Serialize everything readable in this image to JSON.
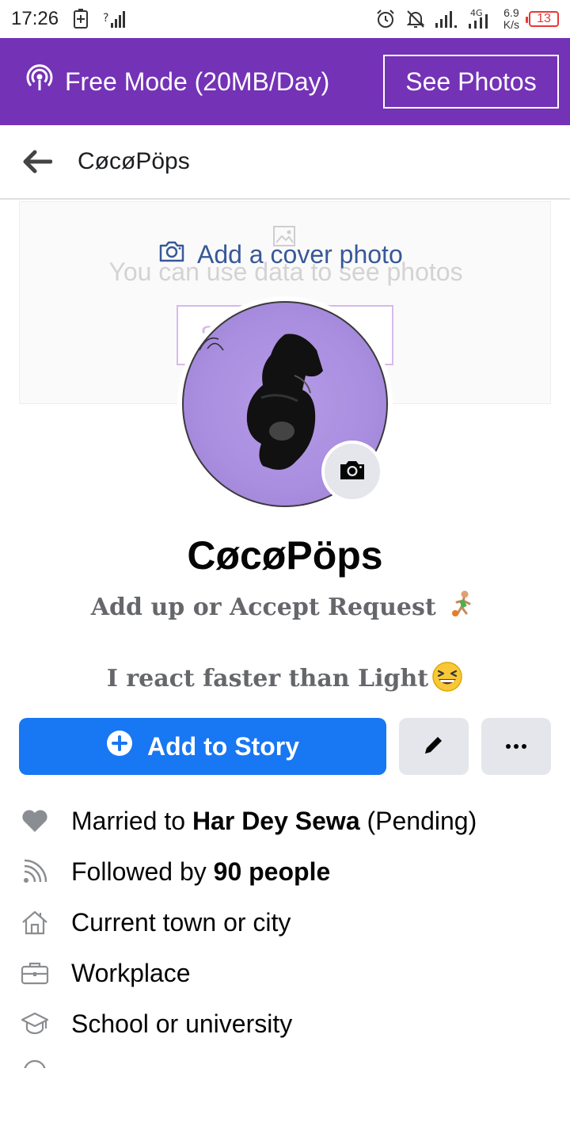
{
  "status_bar": {
    "time": "17:26",
    "speed_value": "6.9",
    "speed_unit": "K/s",
    "network_label": "4G",
    "battery": "13"
  },
  "free_banner": {
    "label": "Free Mode (20MB/Day)",
    "see_photos": "See Photos",
    "color": "#7432b6"
  },
  "nav": {
    "title": "CøcøPöps"
  },
  "cover": {
    "add_cover_label": "Add a cover photo",
    "bg_text": "You can use data to see photos",
    "bg_button_label": "S"
  },
  "profile": {
    "name": "CøcøPöps",
    "bio_line1": "Add up or Accept Request",
    "bio_line2": "I react faster than Light"
  },
  "actions": {
    "add_story": "Add to Story",
    "accent": "#1877f2"
  },
  "details": {
    "married_prefix": "Married to ",
    "married_name": "Har Dey Sewa",
    "married_suffix": " (Pending)",
    "followed_prefix": "Followed by ",
    "followed_count": "90 people",
    "town": "Current town or city",
    "workplace": "Workplace",
    "school": "School or university"
  }
}
